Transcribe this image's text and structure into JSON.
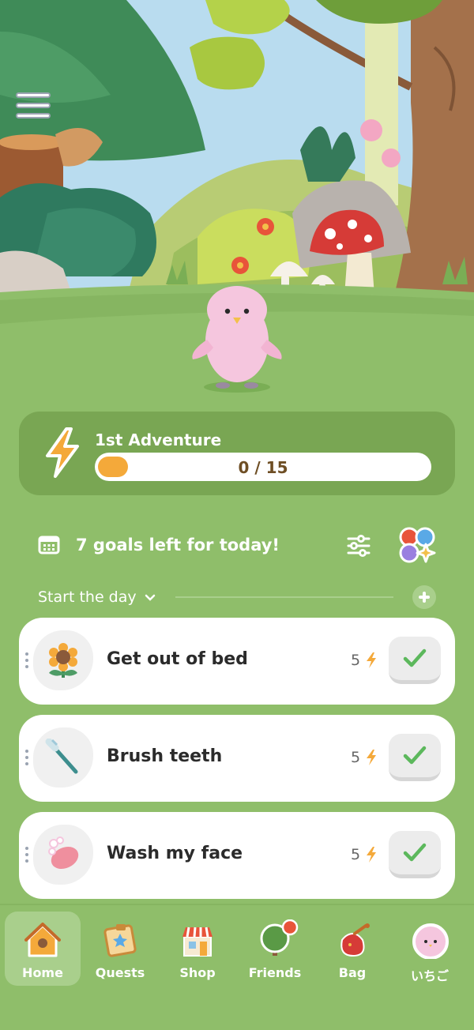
{
  "adventure": {
    "title": "1st Adventure",
    "progress_text": "0 / 15",
    "progress_value": 0,
    "progress_max": 15
  },
  "goals": {
    "summary": "7 goals left for today!"
  },
  "section": {
    "label": "Start the day"
  },
  "tasks": [
    {
      "label": "Get out of bed",
      "points": "5",
      "icon": "sunflower-icon"
    },
    {
      "label": "Brush teeth",
      "points": "5",
      "icon": "toothbrush-icon"
    },
    {
      "label": "Wash my face",
      "points": "5",
      "icon": "soap-icon"
    }
  ],
  "nav": [
    {
      "label": "Home",
      "icon": "house-icon",
      "active": true
    },
    {
      "label": "Quests",
      "icon": "quest-board-icon",
      "active": false
    },
    {
      "label": "Shop",
      "icon": "shop-icon",
      "active": false
    },
    {
      "label": "Friends",
      "icon": "tree-icon",
      "active": false
    },
    {
      "label": "Bag",
      "icon": "bag-icon",
      "active": false
    },
    {
      "label": "いちご",
      "icon": "profile-avatar-icon",
      "active": false
    }
  ],
  "colors": {
    "background": "#8fbe6a",
    "card": "#79a653",
    "accent": "#f4a93a",
    "check": "#5cb85c"
  }
}
